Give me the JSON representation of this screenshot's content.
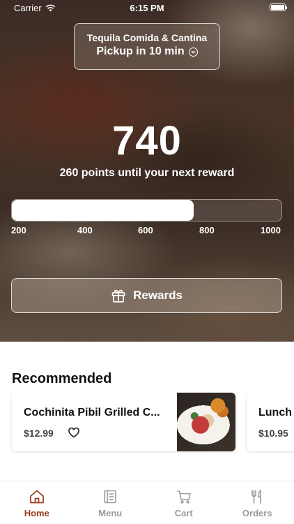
{
  "status_bar": {
    "carrier": "Carrier",
    "time": "6:15 PM"
  },
  "store": {
    "name": "Tequila Comida & Cantina",
    "pickup": "Pickup in 10 min"
  },
  "rewards": {
    "points": "740",
    "until_text": "260 points until your next reward",
    "progress_min": 200,
    "progress_max": 1000,
    "progress_value": 740,
    "ticks": [
      "200",
      "400",
      "600",
      "800",
      "1000"
    ],
    "button_label": "Rewards"
  },
  "recommended": {
    "title": "Recommended",
    "items": [
      {
        "name": "Cochinita Pibil Grilled C...",
        "price": "$12.99"
      },
      {
        "name": "Lunch",
        "price": "$10.95"
      }
    ]
  },
  "tabs": [
    {
      "label": "Home",
      "icon": "home-icon",
      "active": true
    },
    {
      "label": "Menu",
      "icon": "menu-icon",
      "active": false
    },
    {
      "label": "Cart",
      "icon": "cart-icon",
      "active": false
    },
    {
      "label": "Orders",
      "icon": "utensils-icon",
      "active": false
    }
  ],
  "colors": {
    "accent": "#9b3a1c",
    "inactive_tab": "#9a9a9a"
  }
}
